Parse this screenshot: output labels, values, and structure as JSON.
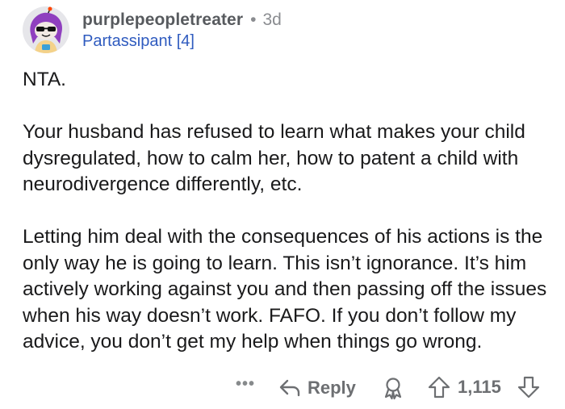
{
  "comment": {
    "username": "purplepeopletreater",
    "separator": "•",
    "age": "3d",
    "flair": "Partassipant [4]",
    "paragraphs": [
      "NTA.",
      "Your husband has refused to learn what makes your child dysregulated, how to calm her, how to patent a child with neurodivergence differently, etc.",
      "Letting him deal with the consequences of his actions is the only way he is going to learn. This isn’t ignorance. It’s him actively working against you and then passing off the issues when his way doesn’t work. FAFO. If you don’t follow my advice, you don’t get my help when things go wrong."
    ]
  },
  "actions": {
    "more_label": "•••",
    "reply_label": "Reply",
    "score": "1,115",
    "icons": [
      "more-icon",
      "reply-arrow-icon",
      "award-icon",
      "upvote-icon",
      "downvote-icon"
    ]
  },
  "colors": {
    "username": "#575a5e",
    "flair": "#2f5bbf",
    "action_gray": "#6d6f72",
    "avatar_hair": "#8f3fbf"
  }
}
